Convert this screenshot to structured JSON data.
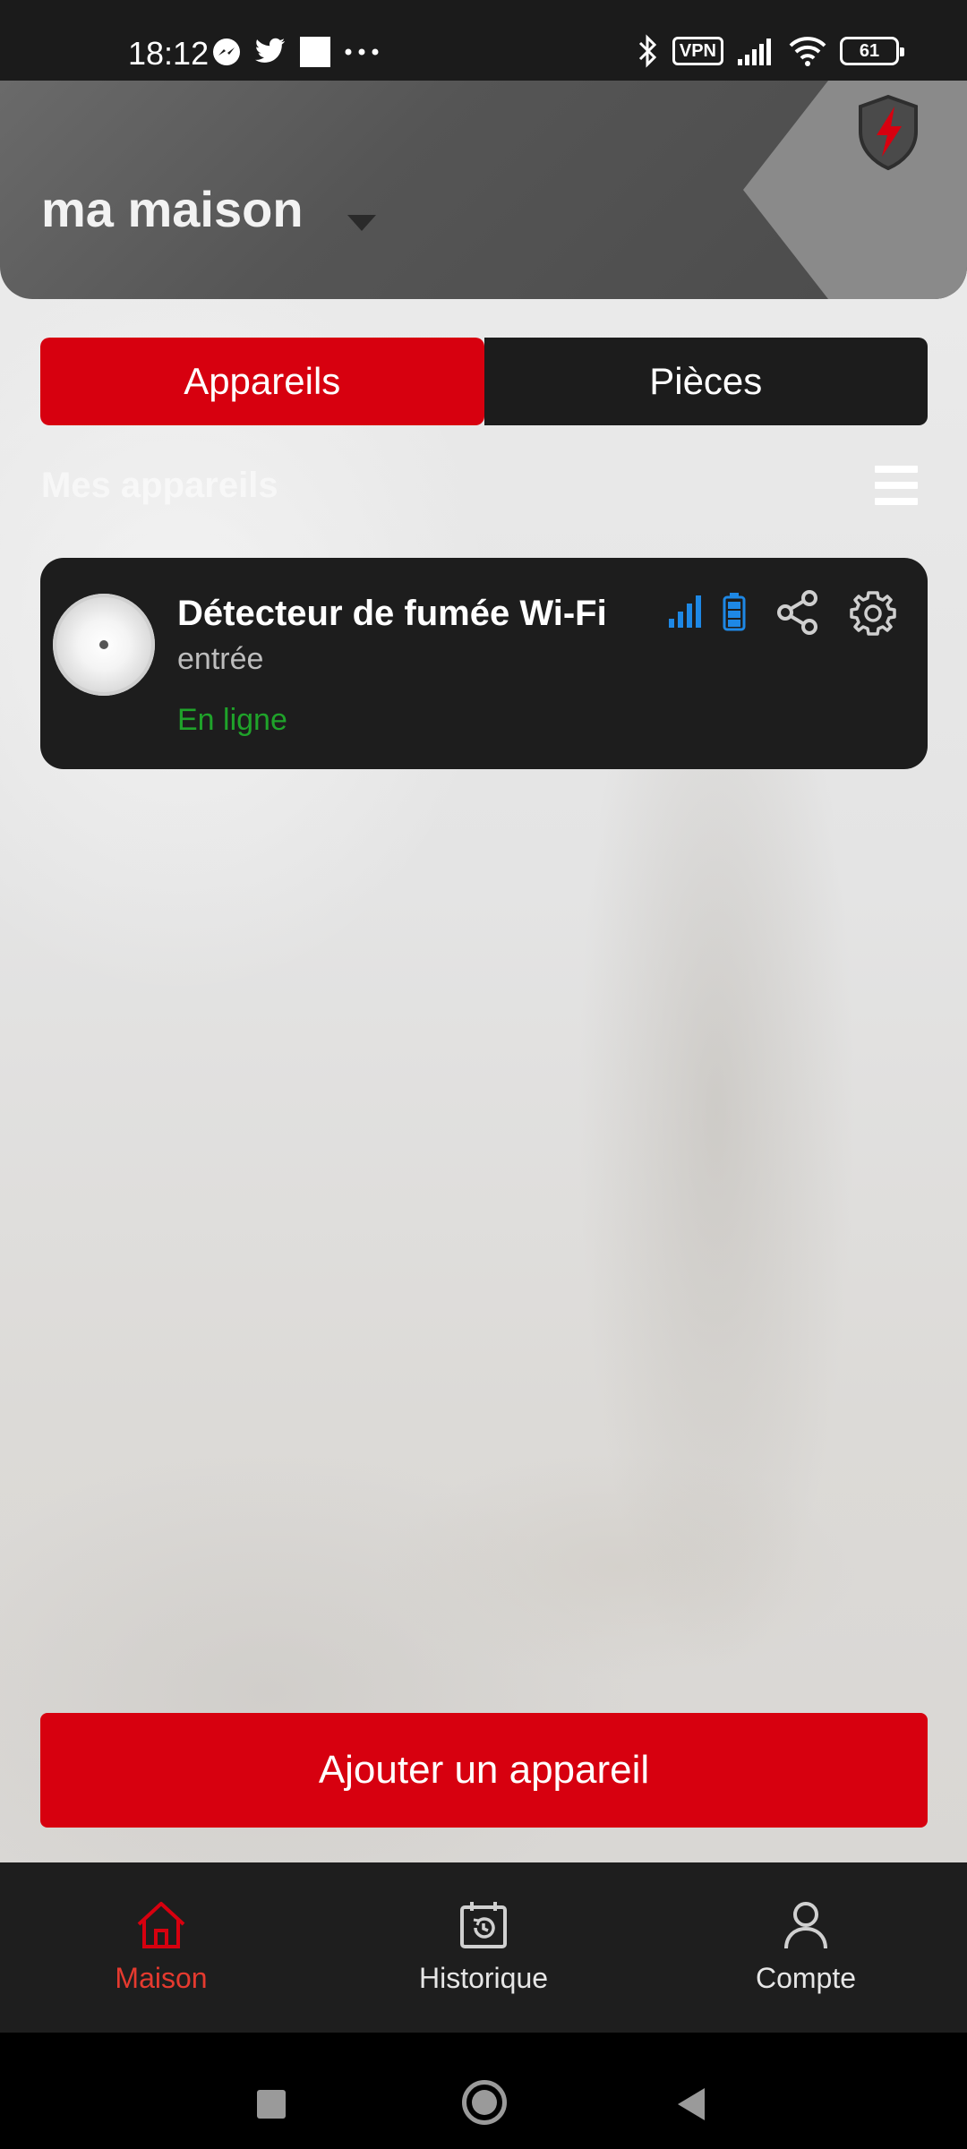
{
  "status_bar": {
    "time": "18:12",
    "vpn_label": "VPN",
    "battery_level": "61",
    "left_icons": [
      "messenger-icon",
      "twitter-icon",
      "square-notification-icon",
      "more-dots-icon"
    ],
    "right_icons": [
      "bluetooth-icon",
      "vpn-icon",
      "cell-signal-icon",
      "wifi-icon",
      "battery-icon"
    ]
  },
  "header": {
    "home_name": "ma maison",
    "logo_icon": "shield-lightning-icon"
  },
  "tabs": [
    {
      "label": "Appareils",
      "active": true
    },
    {
      "label": "Pièces",
      "active": false
    }
  ],
  "section": {
    "title": "Mes appareils"
  },
  "devices": [
    {
      "name": "Détecteur de fumée Wi-Fi",
      "room": "entrée",
      "status": "En ligne",
      "status_color": "#1fa32a",
      "icons": [
        "signal-strength-icon",
        "battery-level-icon",
        "share-icon",
        "settings-gear-icon"
      ]
    }
  ],
  "add_button": {
    "label": "Ajouter un appareil"
  },
  "bottom_nav": [
    {
      "label": "Maison",
      "icon": "home-icon",
      "active": true
    },
    {
      "label": "Historique",
      "icon": "history-calendar-icon",
      "active": false
    },
    {
      "label": "Compte",
      "icon": "person-icon",
      "active": false
    }
  ],
  "colors": {
    "accent": "#d7000f",
    "card_bg": "#1d1d1d",
    "online": "#1fa32a",
    "icon_blue": "#1e88e5"
  }
}
